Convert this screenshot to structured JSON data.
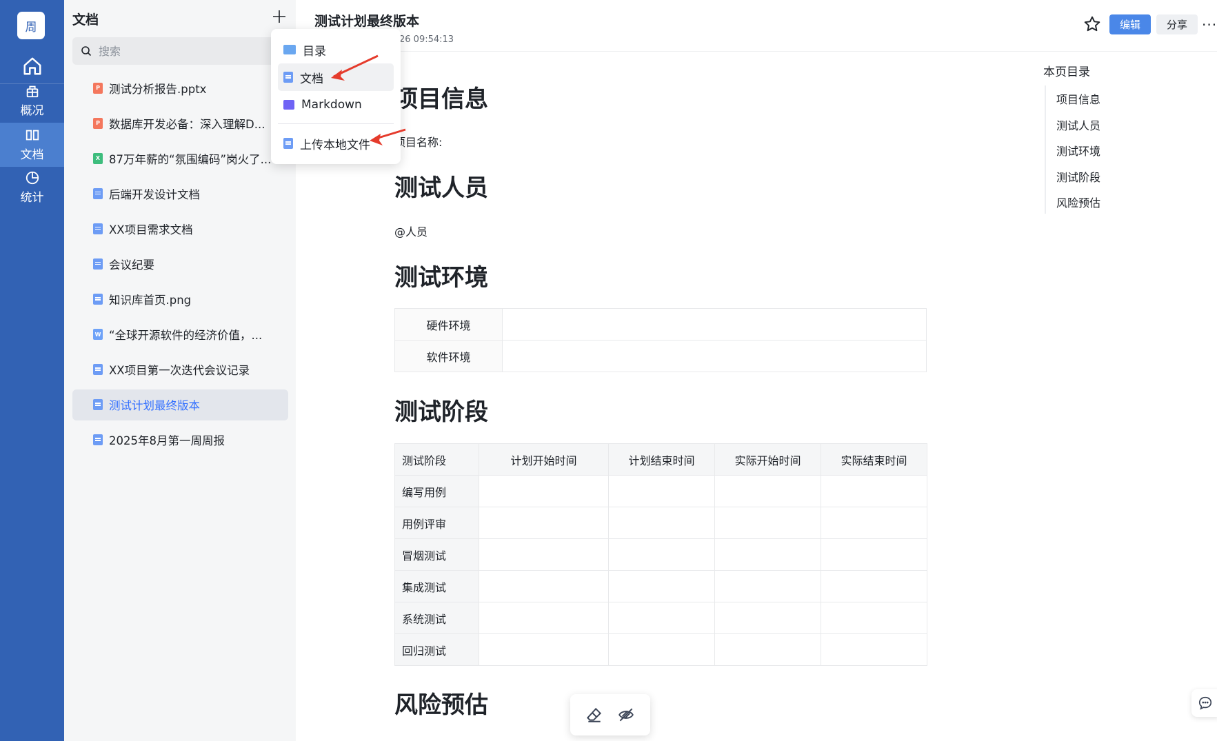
{
  "rail": {
    "avatar": "周",
    "items": [
      {
        "label": "概况"
      },
      {
        "label": "文档"
      },
      {
        "label": "统计"
      }
    ]
  },
  "sidebar": {
    "title": "文档",
    "search_placeholder": "搜索",
    "docs": [
      {
        "label": "测试分析报告.pptx",
        "type": "ppt"
      },
      {
        "label": "数据库开发必备：深入理解D...",
        "type": "ppt"
      },
      {
        "label": "87万年薪的“氛围编码”岗火了...",
        "type": "xls"
      },
      {
        "label": "后端开发设计文档",
        "type": "doc"
      },
      {
        "label": "XX项目需求文档",
        "type": "doc"
      },
      {
        "label": "会议纪要",
        "type": "doc"
      },
      {
        "label": "知识库首页.png",
        "type": "doc"
      },
      {
        "label": "“全球开源软件的经济价值，...",
        "type": "word"
      },
      {
        "label": "XX项目第一次迭代会议记录",
        "type": "doc"
      },
      {
        "label": "测试计划最终版本",
        "type": "doc",
        "active": true
      },
      {
        "label": "2025年8月第一周周报",
        "type": "doc"
      }
    ]
  },
  "menu": {
    "items": [
      {
        "label": "目录",
        "icon": "folder-icon"
      },
      {
        "label": "文档",
        "icon": "doc-icon"
      },
      {
        "label": "Markdown",
        "icon": "markdown-icon"
      },
      {
        "label": "上传本地文件",
        "icon": "upload-doc-icon"
      }
    ]
  },
  "doc": {
    "title": "测试计划最终版本",
    "meta": "26 09:54:13",
    "edit_label": "编辑",
    "share_label": "分享",
    "more_label": "···",
    "h_project": "项目信息",
    "project_name_label": "项目名称:",
    "h_people": "测试人员",
    "people_text": "@人员",
    "h_env": "测试环境",
    "env_rows": [
      "硬件环境",
      "软件环境"
    ],
    "h_stage": "测试阶段",
    "stage_headers": [
      "测试阶段",
      "计划开始时间",
      "计划结束时间",
      "实际开始时间",
      "实际结束时间"
    ],
    "stage_rows": [
      "编写用例",
      "用例评审",
      "冒烟测试",
      "集成测试",
      "系统测试",
      "回归测试"
    ],
    "h_risk": "风险预估"
  },
  "toc": {
    "title": "本页目录",
    "items": [
      "项目信息",
      "测试人员",
      "测试环境",
      "测试阶段",
      "风险预估"
    ]
  },
  "colors": {
    "rail": "#3262b4",
    "accent": "#4a87e8",
    "arrow": "#e53b2c"
  }
}
